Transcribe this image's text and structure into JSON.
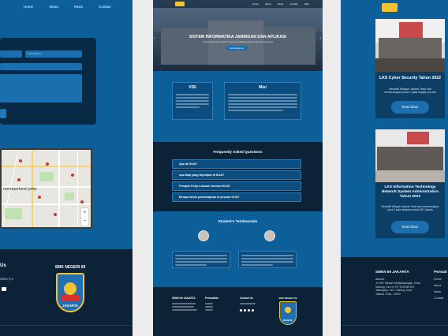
{
  "left": {
    "nav": [
      "Home",
      "About",
      "News",
      "Contact"
    ],
    "form_placeholder": "Last Name",
    "map_text": "memperkecil peta",
    "footer_heading": "Us",
    "footer_phone": "0895-Pp.E",
    "school_logo_top": "SMK NEGERI 69",
    "school_logo_bottom": "JAKARTA"
  },
  "mid": {
    "nav": [
      "Home",
      "About",
      "News",
      "Contact",
      "FAQ"
    ],
    "hero_title": "SISTEM INFORMATIKA JARINGAN DAN APLIKASI",
    "hero_subtitle": "Lorem ipsum dolor sit amet consectetur adipiscing elit sed do eiusmod tempor",
    "hero_button": "Selengkapnya",
    "visi_title": "VISI",
    "misi_title": "Misi",
    "faq_title": "Frequently Asked Questions",
    "faq": [
      "Apa itu SIJA?",
      "Apa Saja yang Dipelajari di SIJA?",
      "Prospek Kerja Lulusan Jurusan SIJA?",
      "Berapa tahun pembelajaran di jurusan SIJA?"
    ],
    "testimonials_title": "Student's Testimonials",
    "footer_cols": [
      "SMKN 69 JAKARTA",
      "Permalinks",
      "Contact Us"
    ],
    "school_logo_top": "SMK NEGERI 69",
    "school_logo_bottom": "JAKARTA"
  },
  "right": {
    "cards": [
      {
        "title": "LKS Cyber Security Tahun 2022",
        "desc": "Mewakili Wilayah Jakarta Timur dan memenangkan juara 1 pada tingkat provinsi",
        "button": "Read More"
      },
      {
        "title": "LKS Information Technology Network System Administration Tahun 2022",
        "desc": "Mewakili Wilayah Jakarta Timur dan memenangkan juara 2 pada tingkat provinsi DKI Jakarta",
        "button": "Read More"
      }
    ],
    "footer_school": "SMKN 69 JAKARTA",
    "footer_address_label": "Alamat :",
    "footer_address": "Jl. KBT Baiquni Wibijasatangan, Desa Kabung, Kec Xi, RT 001/RW 007, Jatinegara, Kec. Cakung, Kota Jakarta Timur, 13920",
    "footer_links_title": "Permali",
    "footer_links": [
      "Home",
      "About",
      "News",
      "Contact"
    ]
  },
  "colors": {
    "primary": "#0c5f99",
    "dark": "#0b2237",
    "card": "#0c4d80",
    "accent": "#f1c232"
  }
}
